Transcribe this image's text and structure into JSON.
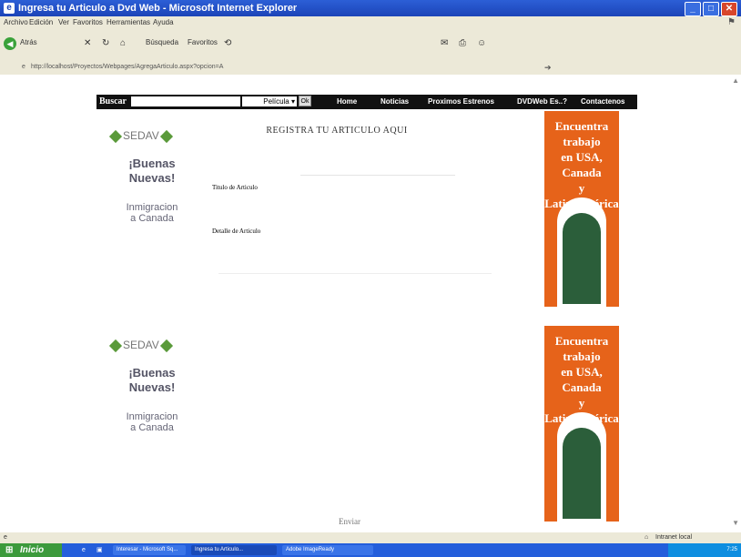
{
  "window": {
    "title": "Ingresa tu Articulo a Dvd Web - Microsoft Internet Explorer",
    "minimize": "_",
    "maximize": "□",
    "close": "✕"
  },
  "menu": [
    "Archivo",
    "Edición",
    "Ver",
    "Favoritos",
    "Herramientas",
    "Ayuda"
  ],
  "toolbar": {
    "back_label": "Atrás",
    "search_label": "Búsqueda",
    "favorites_label": "Favoritos"
  },
  "address": {
    "url": "http://localhost/Proyectos/Webpages/AgregaArticulo.aspx?opcion=A"
  },
  "nav": {
    "search_label": "Buscar",
    "select_value": "Película",
    "ok_label": "Ok",
    "links": [
      "Home",
      "Noticias",
      "Proximos Estrenos",
      "DVDWeb Es..?",
      "Contactenos"
    ]
  },
  "sidebar": {
    "logo_text": "SEDAV",
    "news_line1": "¡Buenas",
    "news_line2": "Nuevas!",
    "immigration_line1": "Inmigracion",
    "immigration_line2": "a Canada"
  },
  "ad": {
    "line1": "Encuentra trabajo",
    "line2": "en USA, Canada",
    "line3": "y Latinoamérica"
  },
  "form": {
    "title": "REGISTRA TU ARTICULO AQUI",
    "title_label": "Titulo de Articulo",
    "detail_label": "Detalle de Articulo",
    "submit_label": "Enviar"
  },
  "status": {
    "zone": "Intranet local"
  },
  "taskbar": {
    "start": "Inicio",
    "tasks": [
      "Interesar - Microsoft Sq...",
      "Ingresa tu Articulo...",
      "Adobe ImageReady"
    ],
    "clock": "7:25"
  },
  "colors": {
    "titlebar": "#1c44b8",
    "nav_bg": "#111111",
    "ad_bg": "#e6631a",
    "taskbar": "#245edb",
    "start": "#3c9a3c"
  }
}
